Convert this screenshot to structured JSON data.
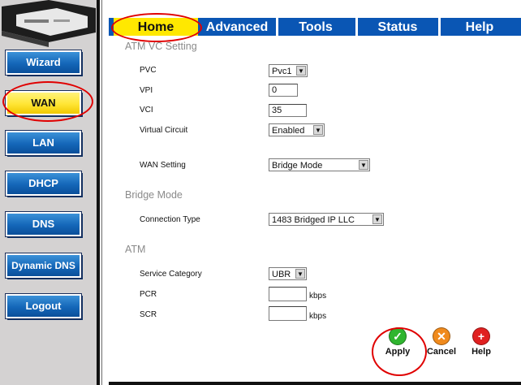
{
  "sidebar": {
    "items": [
      {
        "label": "Wizard",
        "active": false
      },
      {
        "label": "WAN",
        "active": true
      },
      {
        "label": "LAN",
        "active": false
      },
      {
        "label": "DHCP",
        "active": false
      },
      {
        "label": "DNS",
        "active": false
      },
      {
        "label": "Dynamic DNS",
        "active": false
      },
      {
        "label": "Logout",
        "active": false
      }
    ]
  },
  "tabs": [
    {
      "label": "Home",
      "active": true
    },
    {
      "label": "Advanced",
      "active": false
    },
    {
      "label": "Tools",
      "active": false
    },
    {
      "label": "Status",
      "active": false
    },
    {
      "label": "Help",
      "active": false
    }
  ],
  "atm_vc": {
    "title": "ATM VC Setting",
    "pvc_label": "PVC",
    "pvc_value": "Pvc1",
    "vpi_label": "VPI",
    "vpi_value": "0",
    "vci_label": "VCI",
    "vci_value": "35",
    "vc_label": "Virtual Circuit",
    "vc_value": "Enabled"
  },
  "wan": {
    "label": "WAN Setting",
    "value": "Bridge Mode"
  },
  "bridge": {
    "title": "Bridge Mode",
    "conn_label": "Connection Type",
    "conn_value": "1483 Bridged IP LLC"
  },
  "atm": {
    "title": "ATM",
    "service_label": "Service Category",
    "service_value": "UBR",
    "pcr_label": "PCR",
    "pcr_value": "",
    "pcr_unit": "kbps",
    "scr_label": "SCR",
    "scr_value": "",
    "scr_unit": "kbps"
  },
  "actions": {
    "apply": "Apply",
    "cancel": "Cancel",
    "help": "Help"
  },
  "colors": {
    "tab_bar": "#0a56b4",
    "active_tab": "#ffe800",
    "sidebar_button": "#1466b8",
    "annotation": "#e00000"
  }
}
